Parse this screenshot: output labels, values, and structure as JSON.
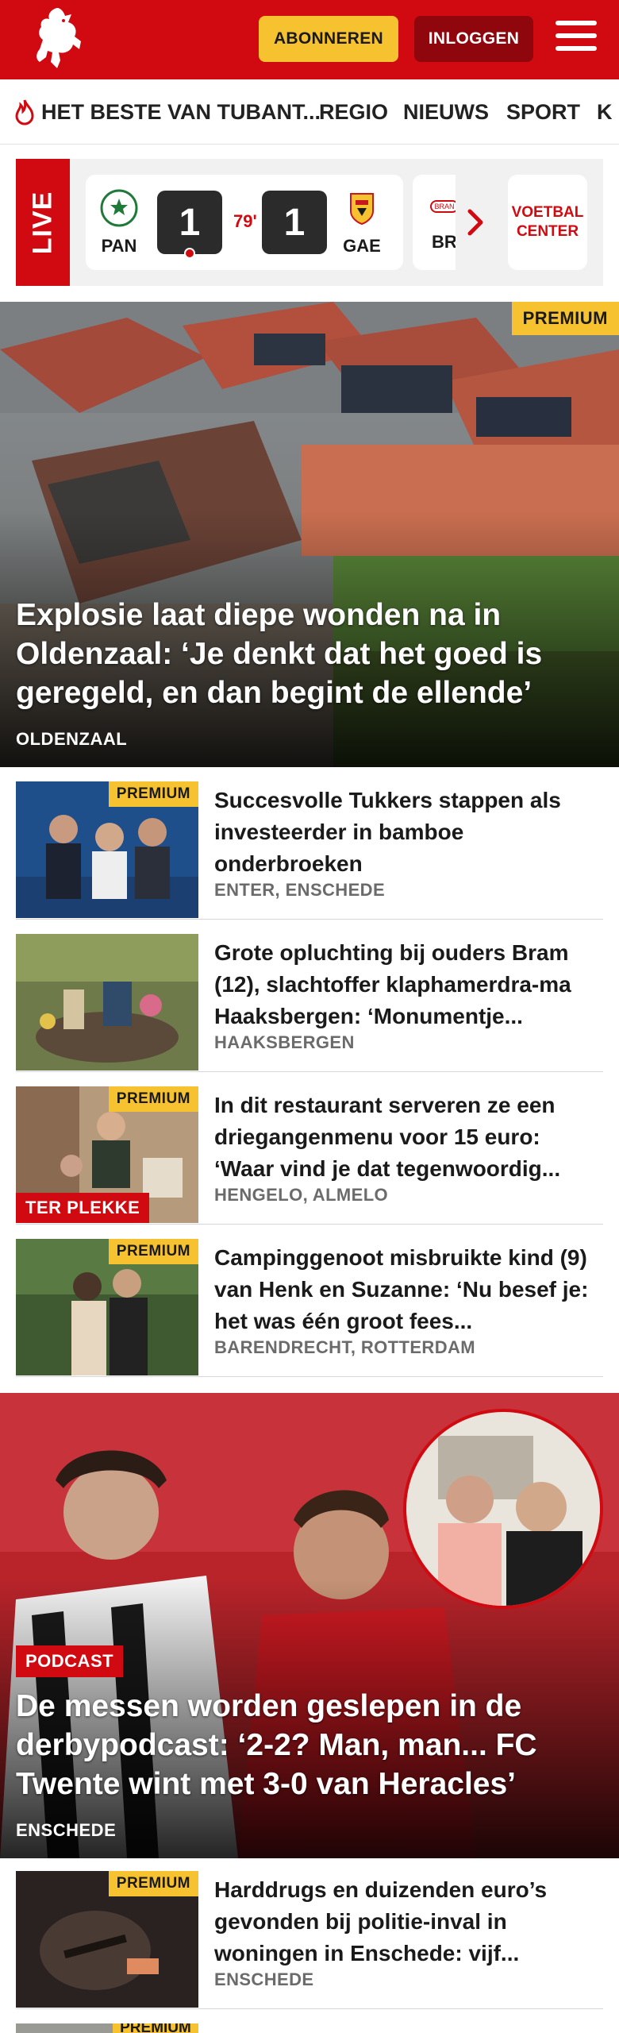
{
  "header": {
    "subscribe_label": "ABONNEREN",
    "login_label": "INLOGGEN",
    "brand_color": "#d10a11",
    "accent_color": "#f6c22f"
  },
  "nav": {
    "items": [
      {
        "label": "HET BESTE VAN TUBANT...",
        "icon": "flame-icon"
      },
      {
        "label": "REGIO"
      },
      {
        "label": "NIEUWS"
      },
      {
        "label": "SPORT"
      },
      {
        "label": "K"
      }
    ]
  },
  "live": {
    "tag": "LIVE",
    "match": {
      "home": "PAN",
      "home_score": "1",
      "minute": "79'",
      "away_score": "1",
      "away": "GAE"
    },
    "next_match_team": "BR",
    "next_match_crest_text": "BRAN",
    "voetbal_center": "VOETBAL CENTER"
  },
  "hero": {
    "badge": "PREMIUM",
    "title": "Explosie laat diepe wonden na in Oldenzaal: ‘Je denkt dat het goed is geregeld, en dan begint de ellende’",
    "location": "OLDENZAAL"
  },
  "articles": [
    {
      "premium": "PREMIUM",
      "title": "Succesvolle Tukkers stappen als investeerder in bamboe onderbroeken",
      "location": "ENTER, ENSCHEDE"
    },
    {
      "title": "Grote opluchting bij ouders Bram (12), slachtoffer klaphamerdra-ma Haaksbergen: ‘Monumentje...",
      "location": "HAAKSBERGEN"
    },
    {
      "premium": "PREMIUM",
      "tag": "TER PLEKKE",
      "title": "In dit restaurant serveren ze een driegangenmenu voor 15 euro: ‘Waar vind je dat tegenwoordig...",
      "location": "HENGELO, ALMELO"
    },
    {
      "premium": "PREMIUM",
      "title": "Campinggenoot misbruikte kind (9) van Henk en Suzanne: ‘Nu besef je: het was één groot fees...",
      "location": "BARENDRECHT, ROTTERDAM"
    }
  ],
  "podcast": {
    "tag": "PODCAST",
    "title": "De messen worden geslepen in de derbypodcast: ‘2-2? Man, man... FC Twente wint met 3-0 van Heracles’",
    "location": "ENSCHEDE"
  },
  "article_bottom": {
    "premium": "PREMIUM",
    "title": "Harddrugs en duizenden euro’s gevonden bij politie-inval in woningen in Enschede: vijf...",
    "location": "ENSCHEDE"
  },
  "article_clipped": {
    "premium": "PREMIUM"
  }
}
